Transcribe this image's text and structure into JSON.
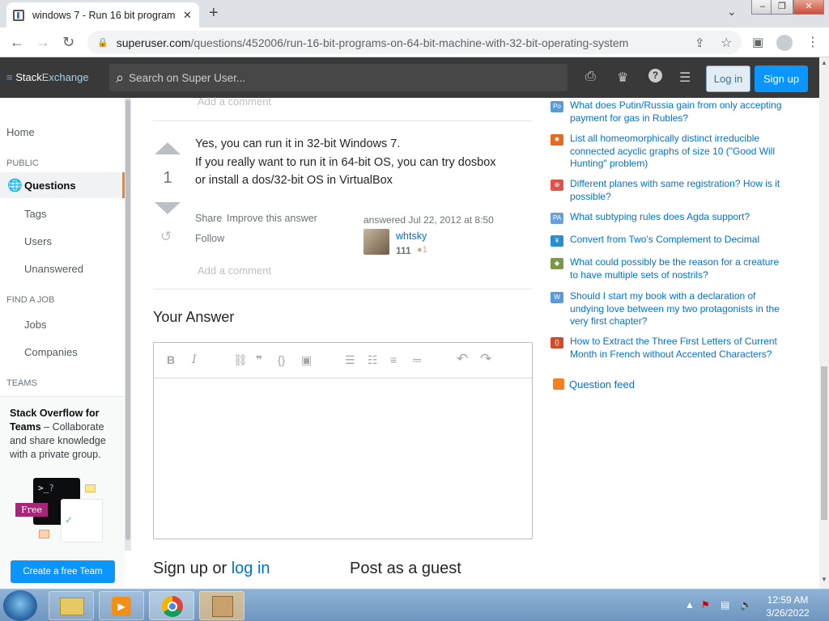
{
  "browser": {
    "tab_title": "windows 7 - Run 16 bit program",
    "tab_close": "✕",
    "new_tab": "+",
    "url_domain": "superuser.com",
    "url_path": "/questions/452006/run-16-bit-programs-on-64-bit-machine-with-32-bit-operating-system"
  },
  "header": {
    "logo_a": "Stack",
    "logo_b": "Exchange",
    "search_placeholder": "Search on Super User...",
    "login": "Log in",
    "signup": "Sign up"
  },
  "leftnav": {
    "home": "Home",
    "public": "PUBLIC",
    "questions": "Questions",
    "tags": "Tags",
    "users": "Users",
    "unanswered": "Unanswered",
    "find_job": "FIND A JOB",
    "jobs": "Jobs",
    "companies": "Companies",
    "teams": "TEAMS",
    "teams_title": "Stack Overflow for Teams",
    "teams_dash": " – ",
    "teams_desc": "Collaborate and share knowledge with a private group.",
    "free_badge": "Free",
    "create_team": "Create a free Team"
  },
  "answer": {
    "add_comment_top": "Add a comment",
    "votes": "1",
    "line1": "Yes, you can run it in 32-bit Windows 7.",
    "line2": "If you really want to run it in 64-bit OS, you can try dosbox",
    "line3": "or install a dos/32-bit OS in VirtualBox",
    "share": "Share",
    "improve": "Improve this answer",
    "follow": "Follow",
    "answered": "answered Jul 22, 2012 at 8:50",
    "user": "whtsky",
    "rep": "111",
    "badge": "●1",
    "add_comment": "Add a comment"
  },
  "editor": {
    "heading": "Your Answer"
  },
  "bottom": {
    "signup_text": "Sign up or ",
    "login_link": "log in",
    "guest": "Post as a guest"
  },
  "hot_questions": [
    {
      "text": "What does Putin/Russia gain from only accepting payment for gas in Rubles?",
      "icon_color": "#5b9bd5",
      "icon_text": "Po"
    },
    {
      "text": "List all homeomorphically distinct irreducible connected acyclic graphs of size 10 (\"Good Will Hunting\" problem)",
      "icon_color": "#e66a1e",
      "icon_text": "✹"
    },
    {
      "text": "Different planes with same registration? How is it possible?",
      "icon_color": "#e0524a",
      "icon_text": "⊕"
    },
    {
      "text": "What subtyping rules does Agda support?",
      "icon_color": "#6aa0d8",
      "icon_text": "PA"
    },
    {
      "text": "Convert from Two's Complement to Decimal",
      "icon_color": "#2a8fd0",
      "icon_text": "¥"
    },
    {
      "text": "What could possibly be the reason for a creature to have multiple sets of nostrils?",
      "icon_color": "#7b9a48",
      "icon_text": "◆"
    },
    {
      "text": "Should I start my book with a declaration of undying love between my two protagonists in the very first chapter?",
      "icon_color": "#5b9bd5",
      "icon_text": "W"
    },
    {
      "text": "How to Extract the Three First Letters of Current Month in French without Accented Characters?",
      "icon_color": "#d24a2c",
      "icon_text": "{}"
    }
  ],
  "feed": "Question feed",
  "taskbar": {
    "time": "12:59 AM",
    "date": "3/26/2022"
  }
}
